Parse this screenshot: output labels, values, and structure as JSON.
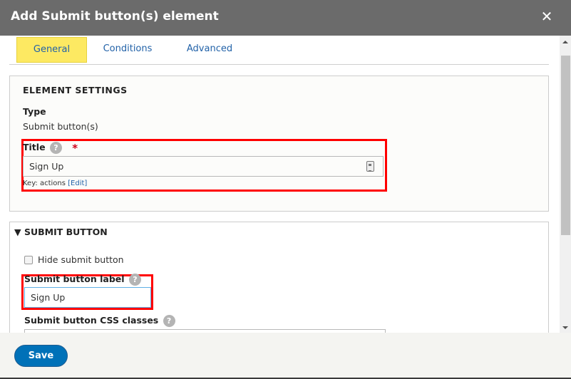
{
  "dialog": {
    "title": "Add Submit button(s) element",
    "close_label": "✕"
  },
  "tabs": [
    {
      "label": "General",
      "active": true
    },
    {
      "label": "Conditions",
      "active": false
    },
    {
      "label": "Advanced",
      "active": false
    }
  ],
  "element_settings": {
    "legend": "ELEMENT SETTINGS",
    "type_label": "Type",
    "type_value": "Submit button(s)",
    "title_label": "Title",
    "help_glyph": "?",
    "required_marker": "*",
    "title_value": "Sign Up",
    "key_prefix": "Key: actions",
    "key_edit_link": "[Edit]"
  },
  "submit_button": {
    "summary": "▼ SUBMIT BUTTON",
    "hide_checkbox_label": "Hide submit button",
    "hide_checked": false,
    "label_field_label": "Submit button label",
    "label_value": "Sign Up",
    "css_classes_label": "Submit button CSS classes",
    "css_classes_value": ""
  },
  "footer": {
    "save_label": "Save"
  },
  "colors": {
    "titlebar": "#6b6b6b",
    "active_tab": "#fde962",
    "link": "#2262a8",
    "primary_button": "#0071b8",
    "highlight_box": "#ff0000",
    "required": "#d0021b"
  }
}
